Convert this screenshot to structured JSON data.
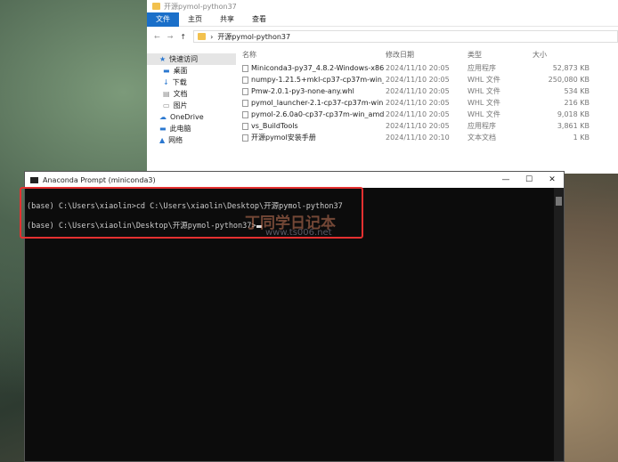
{
  "explorer": {
    "title": "开源pymol-python37",
    "ribbon_tabs": [
      "文件",
      "主页",
      "共享",
      "查看"
    ],
    "address": "开源pymol-python37",
    "sidebar": [
      "快速访问",
      "桌面",
      "下载",
      "文档",
      "图片",
      "OneDrive",
      "此电脑",
      "网络"
    ],
    "columns": [
      "名称",
      "修改日期",
      "类型",
      "大小"
    ],
    "files": [
      {
        "name": "Miniconda3-py37_4.8.2-Windows-x86...",
        "date": "2024/11/10 20:05",
        "type": "应用程序",
        "size": "52,873 KB"
      },
      {
        "name": "numpy-1.21.5+mkl-cp37-cp37m-win_...",
        "date": "2024/11/10 20:05",
        "type": "WHL 文件",
        "size": "250,080 KB"
      },
      {
        "name": "Pmw-2.0.1-py3-none-any.whl",
        "date": "2024/11/10 20:05",
        "type": "WHL 文件",
        "size": "534 KB"
      },
      {
        "name": "pymol_launcher-2.1-cp37-cp37m-win...",
        "date": "2024/11/10 20:05",
        "type": "WHL 文件",
        "size": "216 KB"
      },
      {
        "name": "pymol-2.6.0a0-cp37-cp37m-win_amd...",
        "date": "2024/11/10 20:05",
        "type": "WHL 文件",
        "size": "9,018 KB"
      },
      {
        "name": "vs_BuildTools",
        "date": "2024/11/10 20:05",
        "type": "应用程序",
        "size": "3,861 KB"
      },
      {
        "name": "开源pymol安装手册",
        "date": "2024/11/10 20:10",
        "type": "文本文档",
        "size": "1 KB"
      }
    ]
  },
  "console": {
    "title": "Anaconda Prompt (miniconda3)",
    "lines": [
      "(base) C:\\Users\\xiaolin>cd C:\\Users\\xiaolin\\Desktop\\开源pymol-python37",
      "(base) C:\\Users\\xiaolin\\Desktop\\开源pymol-python37>"
    ]
  },
  "watermark": {
    "name": "丁同学日记本",
    "url": "www.ts006.net"
  },
  "colors": {
    "accent": "#1a6fc9",
    "highlight": "#e53030"
  }
}
